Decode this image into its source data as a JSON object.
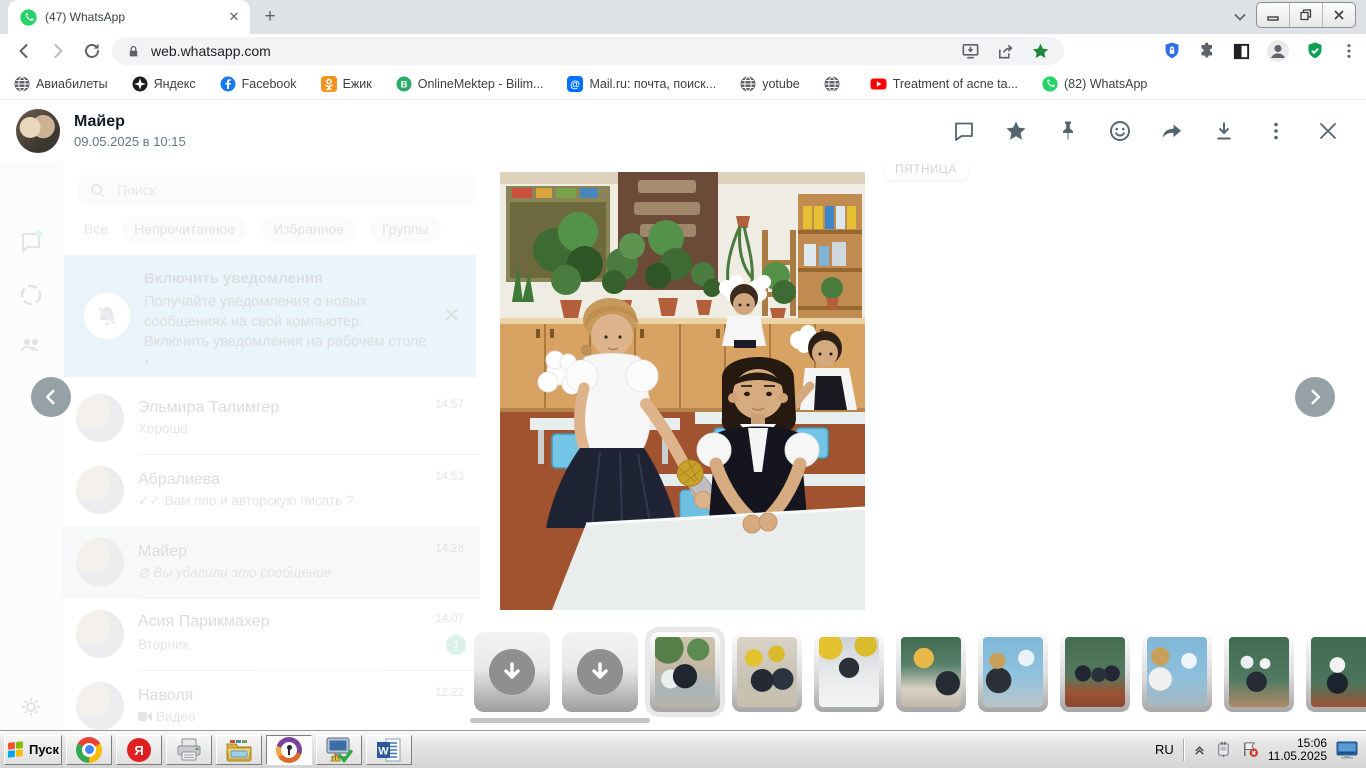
{
  "browser": {
    "tab_title": "(47) WhatsApp",
    "url": "web.whatsapp.com",
    "bookmarks": [
      {
        "label": "Авиабилеты",
        "icon": "globe-icon"
      },
      {
        "label": "Яндекс",
        "icon": "yandex-icon"
      },
      {
        "label": "Facebook",
        "icon": "facebook-icon"
      },
      {
        "label": "Ежик",
        "icon": "odnoklassniki-icon"
      },
      {
        "label": "OnlineMektep - Bilim...",
        "icon": "onlinemektep-icon"
      },
      {
        "label": "Mail.ru: почта, поиск...",
        "icon": "mailru-icon"
      },
      {
        "label": "yotube",
        "icon": "globe-icon"
      },
      {
        "label": "",
        "icon": "globe-icon"
      },
      {
        "label": "Treatment of acne ta...",
        "icon": "youtube-icon"
      },
      {
        "label": "(82) WhatsApp",
        "icon": "whatsapp-icon"
      }
    ]
  },
  "viewer": {
    "sender_name": "Майер",
    "sent_at": "09.05.2025 в 10:15",
    "photo_description": "Classroom: schoolgirl in white blouse hands a karaoke microphone to a seated girl in black pinafore; potted plants on wooden cabinets, blue desks",
    "action_icons": [
      "comment-icon",
      "star-icon",
      "pin-icon",
      "react-icon",
      "forward-icon",
      "download-icon",
      "menu-icon",
      "close-icon"
    ]
  },
  "whatsapp_background": {
    "search_placeholder": "Поиск",
    "filters": [
      "Все",
      "Непрочитанное",
      "Избранное",
      "Группы"
    ],
    "notification_banner": {
      "title": "Включить уведомления",
      "line1": "Получайте уведомления о новых",
      "line2": "сообщениях на свой компьютер.",
      "link": "Включить уведомления на рабочем столе",
      "chevron": "›",
      "close": "✕"
    },
    "date_separator": "ПЯТНИЦА",
    "chats": [
      {
        "name": "Эльмира Талимгер",
        "preview": "Хорошо",
        "time": "14:57"
      },
      {
        "name": "Абралиева",
        "ticks": "✓✓",
        "preview": "Вам ппо и авторскую писать ?",
        "time": "14:53"
      },
      {
        "name": "Майер",
        "deleted_icon": "⊘",
        "preview": "Вы удалили это сообщение",
        "time": "14:28"
      },
      {
        "name": "Асия Парикмахер",
        "preview": "Вторник",
        "time": "14:07",
        "unread": "1"
      },
      {
        "name": "Наволя",
        "preview": "Видео",
        "time": "12:22"
      }
    ]
  },
  "taskbar": {
    "start_label": "Пуск",
    "app_icons": [
      "chrome-icon",
      "yandex-browser-icon",
      "printer-icon",
      "folder-icon",
      "avast-browser-icon",
      "system-check-icon",
      "word-icon"
    ],
    "tray": {
      "language": "RU",
      "time": "15:06",
      "date": "11.05.2025"
    }
  }
}
